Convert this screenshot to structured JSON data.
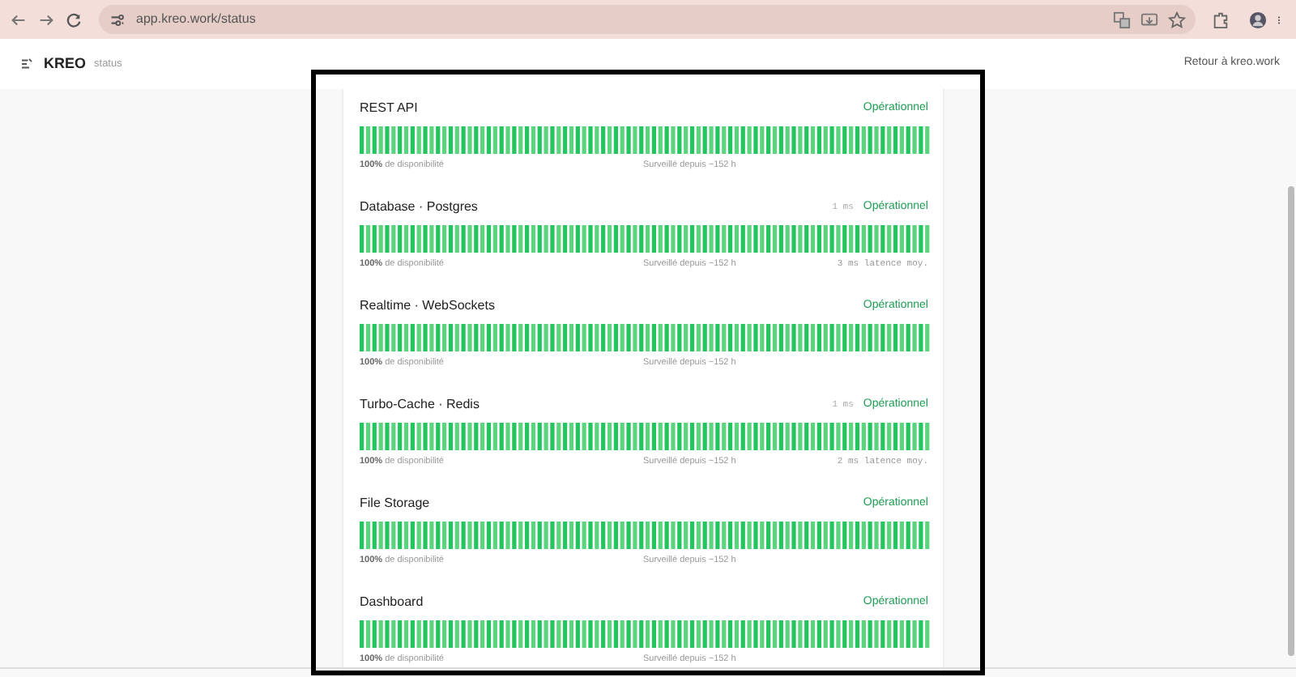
{
  "browser": {
    "url": "app.kreo.work/status"
  },
  "header": {
    "brand": "KREO",
    "subtitle": "status",
    "back_link": "Retour à kreo.work"
  },
  "services": [
    {
      "name": "REST API",
      "status": "Opérationnel",
      "uptime": "100%",
      "uptime_label": "de disponibilité",
      "monitored": "Surveillé depuis ~152 h"
    },
    {
      "name": "Database · Postgres",
      "latency": "1 ms",
      "status": "Opérationnel",
      "uptime": "100%",
      "uptime_label": "de disponibilité",
      "monitored": "Surveillé depuis ~152 h",
      "avg_latency": "3 ms latence moy."
    },
    {
      "name": "Realtime · WebSockets",
      "status": "Opérationnel",
      "uptime": "100%",
      "uptime_label": "de disponibilité",
      "monitored": "Surveillé depuis ~152 h"
    },
    {
      "name": "Turbo-Cache · Redis",
      "latency": "1 ms",
      "status": "Opérationnel",
      "uptime": "100%",
      "uptime_label": "de disponibilité",
      "monitored": "Surveillé depuis ~152 h",
      "avg_latency": "2 ms latence moy."
    },
    {
      "name": "File Storage",
      "status": "Opérationnel",
      "uptime": "100%",
      "uptime_label": "de disponibilité",
      "monitored": "Surveillé depuis ~152 h"
    },
    {
      "name": "Dashboard",
      "status": "Opérationnel",
      "uptime": "100%",
      "uptime_label": "de disponibilité",
      "monitored": "Surveillé depuis ~152 h"
    }
  ]
}
